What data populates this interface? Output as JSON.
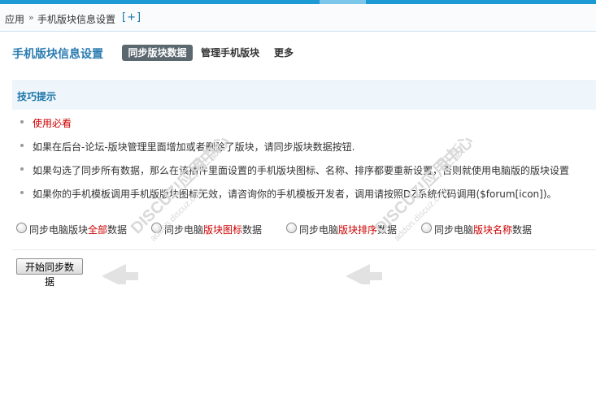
{
  "breadcrumb": {
    "app": "应用",
    "separator": "»",
    "current": "手机版块信息设置",
    "add_label": "[+]"
  },
  "page": {
    "title": "手机版块信息设置",
    "tabs": [
      {
        "label": "同步版块数据",
        "active": true
      },
      {
        "label": "管理手机版块",
        "active": false
      },
      {
        "label": "更多",
        "active": false
      }
    ]
  },
  "tips": {
    "title": "技巧提示",
    "items": [
      "使用必看",
      "如果在后台-论坛-版块管理里面增加或者删除了版块，请同步版块数据按钮.",
      "如果勾选了同步所有数据，那么在该插件里面设置的手机版块图标、名称、排序都要重新设置，否则就使用电脑版的版块设置",
      "如果你的手机模板调用手机版版块图标无效，请咨询你的手机模板开发者，调用请按照DZ系统代码调用($forum[icon])。"
    ]
  },
  "sync_options": [
    {
      "prefix": "同步电脑版块",
      "highlight": "全部",
      "suffix": "数据",
      "checked": false
    },
    {
      "prefix": "同步电脑",
      "highlight": "版块图标",
      "suffix": "数据",
      "checked": false
    },
    {
      "prefix": "同步电脑",
      "highlight": "版块排序",
      "suffix": "数据",
      "checked": false
    },
    {
      "prefix": "同步电脑",
      "highlight": "版块名称",
      "suffix": "数据",
      "checked": false
    }
  ],
  "submit_label": "开始同步数据",
  "watermark": {
    "brand": "DISCUZ!应用中心",
    "url": "addon.discuz.com",
    "suffix": "正版"
  },
  "colors": {
    "topbar": "#1b9ad4",
    "link": "#1a74a8",
    "highlight": "#cc0000",
    "active_tab_bg": "#5c6870"
  }
}
